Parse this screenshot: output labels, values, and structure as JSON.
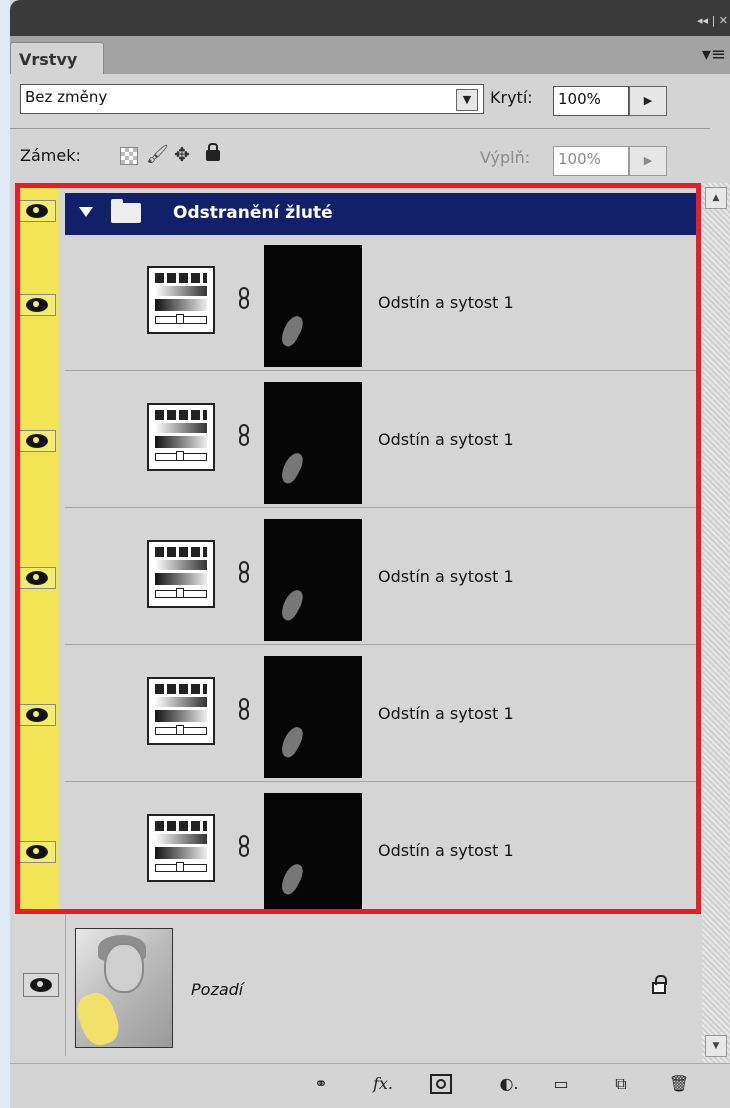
{
  "panel": {
    "tab_label": "Vrstvy",
    "titlebar_controls": "◂◂ | ✕",
    "menu_icon": "panel-menu-icon"
  },
  "blend_mode": {
    "value": "Bez změny"
  },
  "opacity": {
    "label": "Krytí:",
    "value": "100%"
  },
  "lock": {
    "label": "Zámek:"
  },
  "fill": {
    "label": "Výplň:",
    "value": "100%"
  },
  "group": {
    "name": "Odstranění žluté",
    "expanded": true
  },
  "layers": [
    {
      "name": "Odstín a sytost 1",
      "visible": true
    },
    {
      "name": "Odstín a sytost 1",
      "visible": true
    },
    {
      "name": "Odstín a sytost 1",
      "visible": true
    },
    {
      "name": "Odstín a sytost 1",
      "visible": true
    },
    {
      "name": "Odstín a sytost 1",
      "visible": true
    }
  ],
  "background_layer": {
    "name": "Pozadí",
    "locked": true,
    "visible": true
  },
  "colors": {
    "highlight": "#ea1c24",
    "eye_column": "#f2e555",
    "group_bar": "#12206a"
  },
  "bottom_tools": [
    "link-icon",
    "fx-icon",
    "mask-icon",
    "adjustment-icon",
    "folder-icon",
    "new-layer-icon",
    "trash-icon"
  ]
}
